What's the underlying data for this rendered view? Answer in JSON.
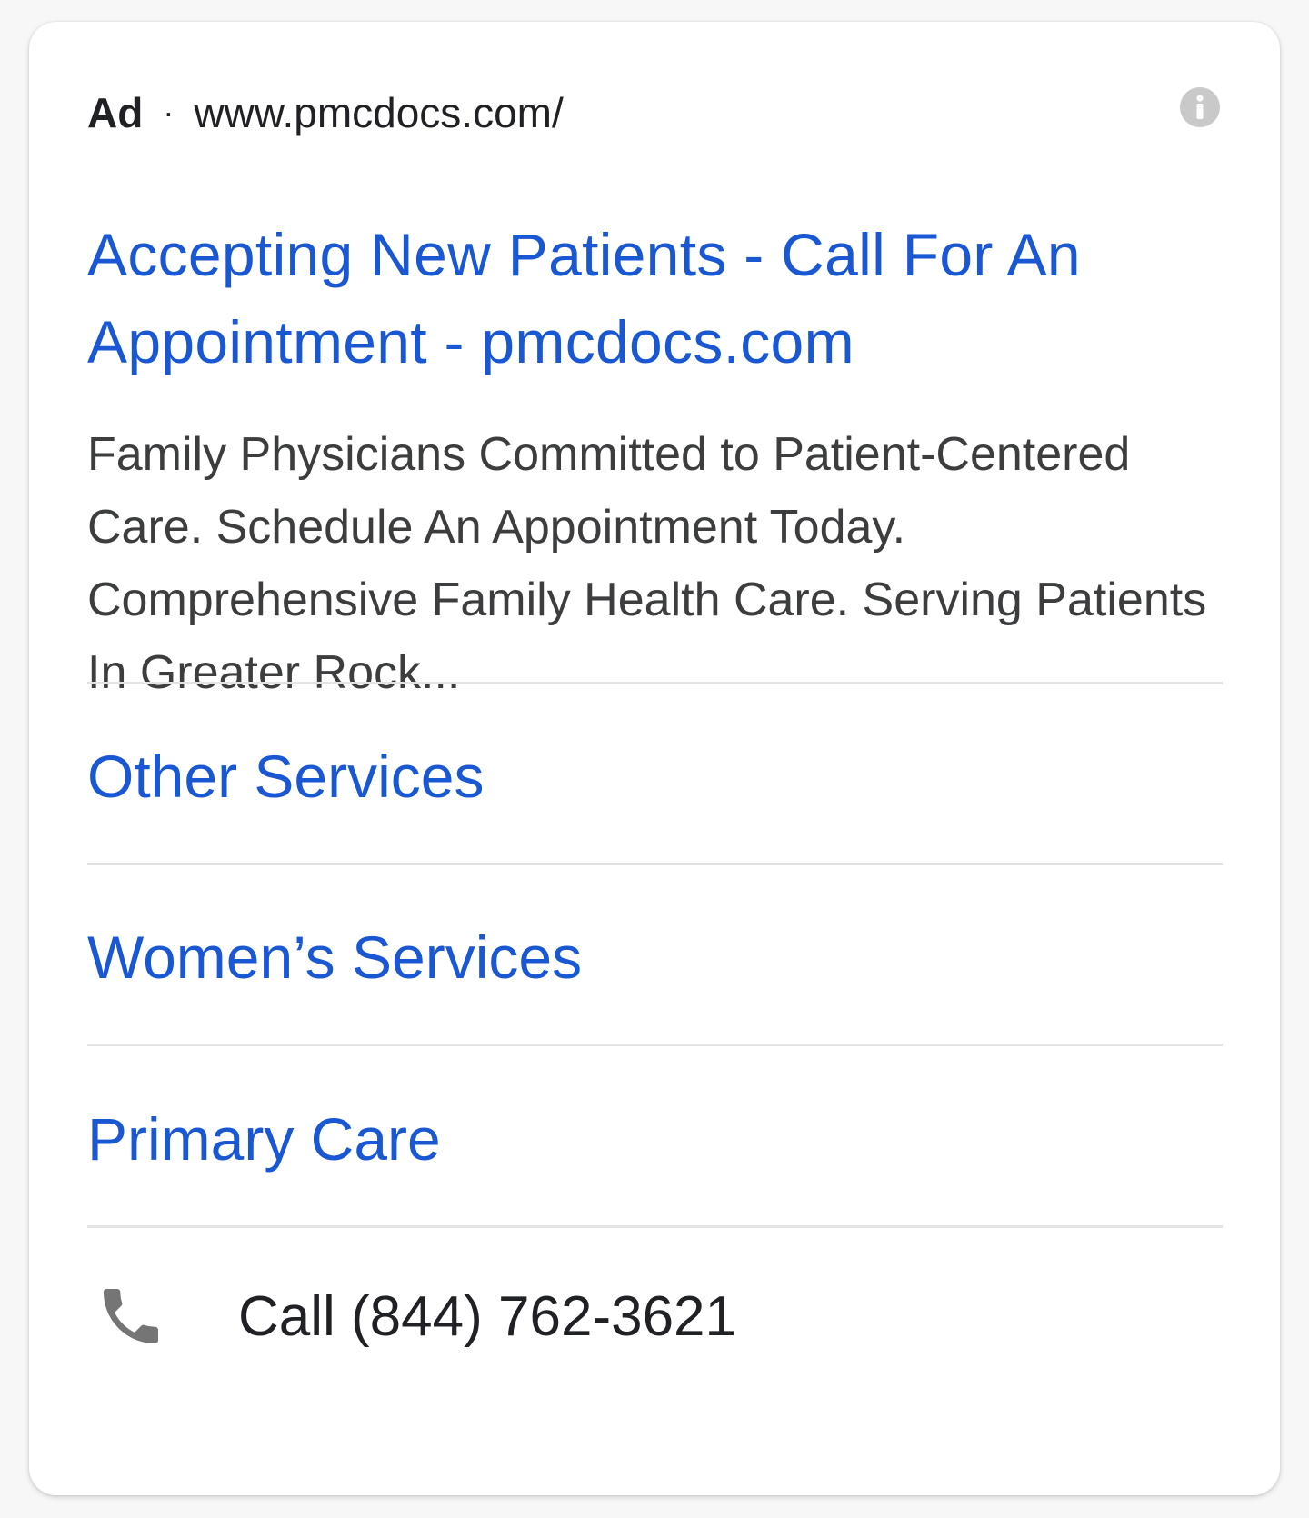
{
  "ad": {
    "badge": "Ad",
    "separator": "·",
    "display_url": "www.pmcdocs.com/",
    "info_icon": "info-icon",
    "headline": "Accepting New Patients - Call For An Appointment - pmcdocs.com",
    "description": "Family Physicians Committed to Patient-Centered Care. Schedule An Appointment Today. Comprehensive Family Health Care. Serving Patients In Greater Rock..."
  },
  "sitelinks": [
    {
      "label": "Other Services"
    },
    {
      "label": "Women’s Services"
    },
    {
      "label": "Primary Care"
    }
  ],
  "call": {
    "icon": "phone-icon",
    "label": "Call (844) 762-3621"
  },
  "colors": {
    "link": "#1a57d2",
    "text": "#202124",
    "description": "#3c3d3f",
    "divider": "#e3e3e3",
    "icon": "#757575"
  }
}
